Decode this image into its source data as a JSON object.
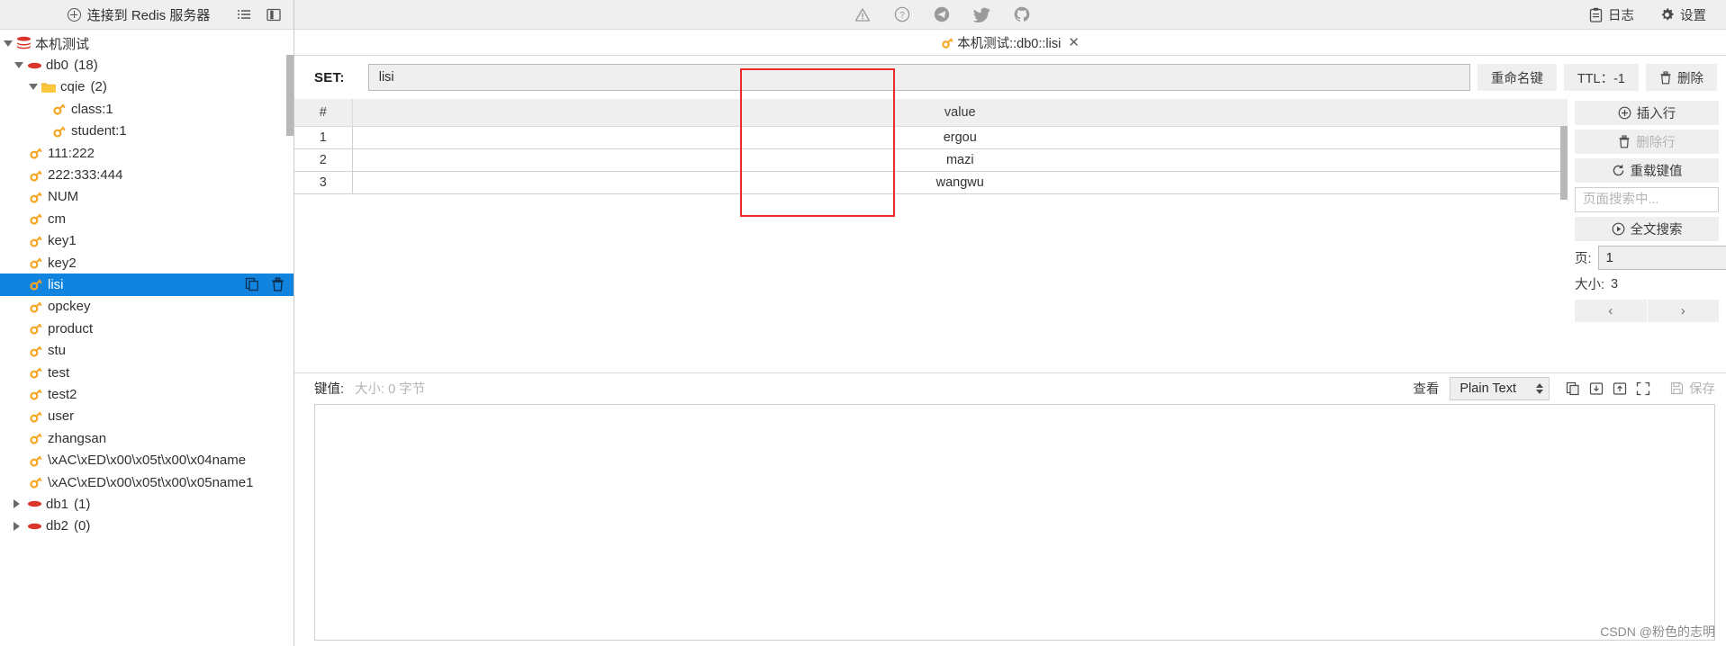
{
  "topbar": {
    "connect_label": "连接到 Redis 服务器",
    "left_icons": [
      {
        "name": "list-view-icon"
      },
      {
        "name": "split-panel-icon"
      }
    ],
    "social_icons": [
      {
        "name": "warning-icon"
      },
      {
        "name": "help-icon"
      },
      {
        "name": "telegram-icon"
      },
      {
        "name": "twitter-icon"
      },
      {
        "name": "github-icon"
      }
    ],
    "log_label": "日志",
    "settings_label": "设置"
  },
  "sidebar": {
    "connection": {
      "label": "本机测试",
      "icon": "redis-stack-icon"
    },
    "databases": [
      {
        "label": "db0",
        "count": "(18)",
        "icon": "db-icon",
        "expanded": true
      },
      {
        "label": "db1",
        "count": "(1)",
        "icon": "db-icon",
        "expanded": false
      },
      {
        "label": "db2",
        "count": "(0)",
        "icon": "db-icon",
        "expanded": false
      }
    ],
    "folder": {
      "label": "cqie",
      "count": "(2)",
      "icon": "folder-icon"
    },
    "folder_keys": [
      {
        "label": "class:1",
        "icon": "key-icon"
      },
      {
        "label": "student:1",
        "icon": "key-icon"
      }
    ],
    "keys": [
      {
        "label": "111:222",
        "icon": "key-icon",
        "selected": false
      },
      {
        "label": "222:333:444",
        "icon": "key-icon",
        "selected": false
      },
      {
        "label": "NUM",
        "icon": "key-icon",
        "selected": false
      },
      {
        "label": "cm",
        "icon": "key-icon",
        "selected": false
      },
      {
        "label": "key1",
        "icon": "key-icon",
        "selected": false
      },
      {
        "label": "key2",
        "icon": "key-icon",
        "selected": false
      },
      {
        "label": "lisi",
        "icon": "key-icon",
        "selected": true
      },
      {
        "label": "opckey",
        "icon": "key-icon",
        "selected": false
      },
      {
        "label": "product",
        "icon": "key-icon",
        "selected": false
      },
      {
        "label": "stu",
        "icon": "key-icon",
        "selected": false
      },
      {
        "label": "test",
        "icon": "key-icon",
        "selected": false
      },
      {
        "label": "test2",
        "icon": "key-icon",
        "selected": false
      },
      {
        "label": "user",
        "icon": "key-icon",
        "selected": false
      },
      {
        "label": "zhangsan",
        "icon": "key-icon",
        "selected": false
      },
      {
        "label": "\\xAC\\xED\\x00\\x05t\\x00\\x04name",
        "icon": "key-icon",
        "selected": false
      },
      {
        "label": "\\xAC\\xED\\x00\\x05t\\x00\\x05name1",
        "icon": "key-icon",
        "selected": false
      }
    ],
    "row_action_icons": [
      {
        "name": "copy-key-icon"
      },
      {
        "name": "delete-key-icon"
      }
    ]
  },
  "tab": {
    "title": "本机测试::db0::lisi",
    "icon": "key-icon",
    "close": "✕"
  },
  "key_header": {
    "type_label": "SET:",
    "key_value": "lisi",
    "rename_label": "重命名键",
    "ttl_label": "TTL：-1",
    "delete_label": "删除"
  },
  "table": {
    "columns": [
      "#",
      "value"
    ],
    "rows": [
      {
        "index": "1",
        "value": "ergou"
      },
      {
        "index": "2",
        "value": "mazi"
      },
      {
        "index": "3",
        "value": "wangwu"
      }
    ]
  },
  "right_panel": {
    "insert_row": "插入行",
    "delete_row": "删除行",
    "reload_value": "重载键值",
    "search_placeholder": "页面搜索中...",
    "full_search": "全文搜索",
    "page_label": "页:",
    "page_value": "1",
    "size_label": "大小:",
    "size_value": "3",
    "prev": "‹",
    "next": "›"
  },
  "value_editor": {
    "kv_label": "键值:",
    "size_text": "大小: 0 字节",
    "view_label": "查看",
    "format_value": "Plain Text",
    "save_label": "保存",
    "content": "",
    "icons": [
      {
        "name": "copy-icon"
      },
      {
        "name": "import-icon"
      },
      {
        "name": "export-icon"
      },
      {
        "name": "fullscreen-icon"
      }
    ]
  },
  "watermark": "CSDN @粉色的志明",
  "colors": {
    "selection": "#1184e0",
    "key_icon": "#f5a623",
    "db_icon": "#d9352c",
    "folder_icon": "#f5bc3c",
    "highlight_box": "#ec2b2b"
  }
}
